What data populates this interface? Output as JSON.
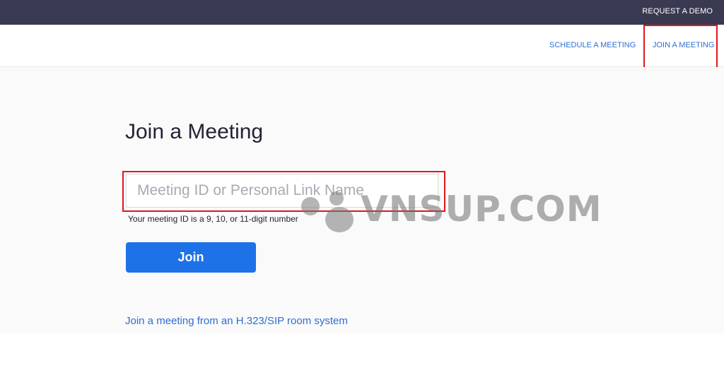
{
  "topbar": {
    "request_demo": "REQUEST A DEMO"
  },
  "nav": {
    "schedule": "SCHEDULE A MEETING",
    "join": "JOIN A MEETING"
  },
  "main": {
    "title": "Join a Meeting",
    "input_placeholder": "Meeting ID or Personal Link Name",
    "helper": "Your meeting ID is a 9, 10, or 11-digit number",
    "join_button": "Join",
    "h323_link": "Join a meeting from an H.323/SIP room system"
  },
  "watermark": {
    "text": "VNSUP.COM"
  },
  "colors": {
    "topbar": "#393a51",
    "link": "#2d6fd1",
    "primary_button": "#1d72e8",
    "highlight_box": "#e4151b"
  }
}
